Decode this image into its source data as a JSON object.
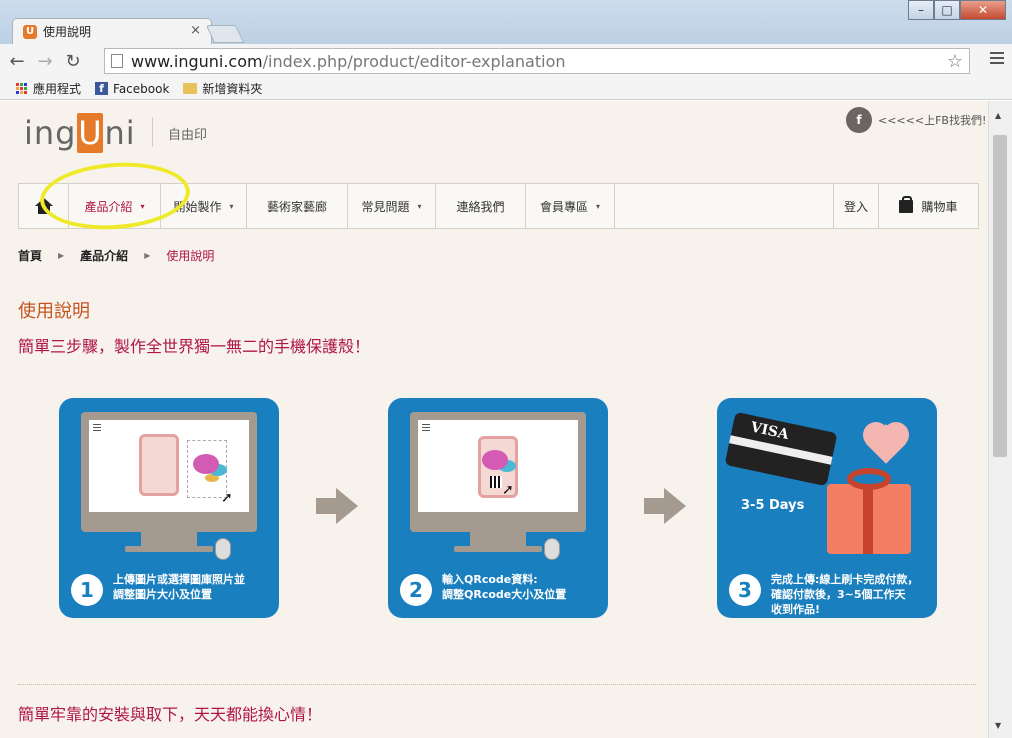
{
  "browser": {
    "tab_title": "使用說明",
    "tab_favicon": "U",
    "url_domain": "www.inguni.com",
    "url_path": "/index.php/product/editor-explanation",
    "bookmarks": [
      {
        "label": "應用程式"
      },
      {
        "label": "Facebook"
      },
      {
        "label": "新增資料夾"
      }
    ]
  },
  "site": {
    "logo_pre": "ing",
    "logo_u": "U",
    "logo_post": "ni",
    "subtitle": "自由印",
    "fb_label": "<<<<<上FB找我們!",
    "fb_icon": "f",
    "nav": [
      {
        "label": "產品介紹",
        "caret": "▾"
      },
      {
        "label": "開始製作",
        "caret": "▾"
      },
      {
        "label": "藝術家藝廊"
      },
      {
        "label": "常見問題",
        "caret": "▾"
      },
      {
        "label": "連絡我們"
      },
      {
        "label": "會員專區",
        "caret": "▾"
      }
    ],
    "login": "登入",
    "cart": "購物車"
  },
  "breadcrumb": [
    "首頁",
    "產品介紹",
    "使用說明"
  ],
  "content": {
    "title": "使用說明",
    "subtitle": "簡單三步驟，製作全世界獨一無二的手機保護殼！",
    "steps": [
      {
        "num": "1",
        "text": "上傳圖片或選擇圖庫照片並\n調整圖片大小及位置"
      },
      {
        "num": "2",
        "text": "輸入QRcode資料:\n調整QRcode大小及位置"
      },
      {
        "num": "3",
        "text": "完成上傳:線上刷卡完成付款，\n確認付款後，3~5個工作天\n收到作品!",
        "days": "3-5 Days",
        "card_text": "VISA"
      }
    ],
    "section2": "簡單牢靠的安裝與取下，天天都能換心情！"
  },
  "colors": {
    "accent": "#b0154a",
    "orange": "#e57a2b",
    "blue": "#1a7fbe",
    "highlight": "#eeea2a"
  }
}
